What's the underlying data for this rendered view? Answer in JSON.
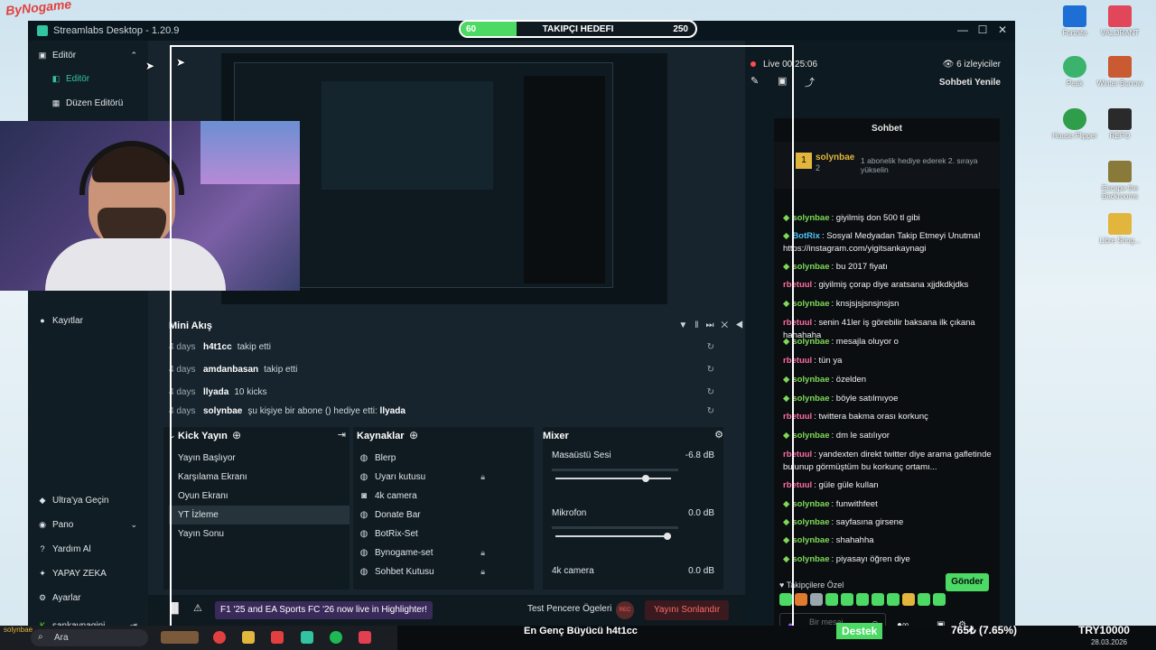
{
  "overlay": {
    "channel_logo": "ByNogame",
    "goal_start": "60",
    "goal_title": "TAKIPÇI HEDEFI",
    "goal_end": "250",
    "goal_progress": 0.24,
    "support_label": "Destek",
    "donation_amount": "765₺ (7.65%)",
    "donation_target": "TRY10000",
    "highlight_label": "En Genç Büyücü h4t1cc",
    "date": "28.03.2026"
  },
  "desktop_icons": [
    "Fortnite",
    "VALORANT",
    "Peak",
    "Winter Burrow",
    "House Flipper",
    "REPO",
    "Escape the Backrooms",
    "Libre Sring..."
  ],
  "window": {
    "title": "Streamlabs Desktop - 1.20.9",
    "minimize_icon": "minimize-icon",
    "maximize_icon": "maximize-icon",
    "close_icon": "close-icon"
  },
  "sidebar": {
    "section": "Editör",
    "items": [
      {
        "label": "Editör",
        "icon": "editor-icon"
      },
      {
        "label": "Düzen Editörü",
        "icon": "layout-icon"
      },
      {
        "label": "Kayıtlar",
        "icon": "record-icon"
      }
    ],
    "bottom": [
      {
        "label": "Ultra'ya Geçin",
        "icon": "ultra-icon"
      },
      {
        "label": "Pano",
        "icon": "dashboard-icon"
      },
      {
        "label": "Yardım Al",
        "icon": "help-icon"
      },
      {
        "label": "YAPAY ZEKA",
        "icon": "ai-icon"
      },
      {
        "label": "Ayarlar",
        "icon": "settings-icon"
      },
      {
        "label": "sankaynagini",
        "icon": "kick-icon"
      }
    ]
  },
  "mini_feed": {
    "title": "Mini Akış",
    "events": [
      {
        "age": "4 days",
        "name": "h4t1cc",
        "text": "takip etti",
        "extra": ""
      },
      {
        "age": "4 days",
        "name": "amdanbasan",
        "text": "takip etti",
        "extra": ""
      },
      {
        "age": "4 days",
        "name": "llyada",
        "text": "10 kicks",
        "extra": ""
      },
      {
        "age": "4 days",
        "name": "solynbae",
        "text": "şu kişiye bir abone () hediye etti:",
        "extra": "llyada"
      }
    ]
  },
  "scenes": {
    "title": "Kick Yayın",
    "items": [
      "Yayın Başlıyor",
      "Karşılama Ekranı",
      "Oyun Ekranı",
      "YT İzleme",
      "Yayın Sonu"
    ],
    "selected": "YT İzleme"
  },
  "sources": {
    "title": "Kaynaklar",
    "items": [
      {
        "label": "Blerp",
        "locked": false
      },
      {
        "label": "Uyarı kutusu",
        "locked": true
      },
      {
        "label": "4k camera",
        "locked": false
      },
      {
        "label": "Donate Bar",
        "locked": false
      },
      {
        "label": "BotRix-Set",
        "locked": false
      },
      {
        "label": "Bynogame-set",
        "locked": true
      },
      {
        "label": "Sohbet Kutusu",
        "locked": true
      }
    ]
  },
  "mixer": {
    "title": "Mixer",
    "channels": [
      {
        "name": "Masaüstü Sesi",
        "db": "-6.8 dB",
        "level": 0.8
      },
      {
        "name": "Mikrofon",
        "db": "0.0 dB",
        "level": 1.0
      },
      {
        "name": "4k camera",
        "db": "0.0 dB",
        "level": 1.0
      }
    ]
  },
  "footer": {
    "highlight": "F1 '25 and EA Sports FC '26 now live in Highlighter!",
    "test_label": "Test Pencere Ögeleri",
    "rec_label": "REC",
    "end_stream": "Yayını Sonlandır"
  },
  "stream": {
    "live_label": "Live 00:25:06",
    "viewers": "6 izleyiciler",
    "refresh_chat": "Sohbeti Yenile",
    "chat_title": "Sohbet",
    "pinned_user": "solynbae",
    "pinned_count": "2",
    "pinned_text": "1 abonelik hediye ederek 2. sıraya yükselin"
  },
  "chat": {
    "messages": [
      {
        "user": "solynbae",
        "color": "#7ed957",
        "text": "giyilmiş don 500 tl gibi"
      },
      {
        "user": "BotRix",
        "color": "#4fc3f7",
        "text": "Sosyal Medyadan Takip Etmeyi Unutma! https://instagram.com/yigitsankaynagi"
      },
      {
        "user": "solynbae",
        "color": "#7ed957",
        "text": "bu 2017 fiyatı"
      },
      {
        "user": "rbetuul",
        "color": "#ff6b9d",
        "text": "giyilmiş çorap diye aratsana xjjdkdkjdks"
      },
      {
        "user": "solynbae",
        "color": "#7ed957",
        "text": "knsjsjsjsnsjnsjsn"
      },
      {
        "user": "rbetuul",
        "color": "#ff6b9d",
        "text": "senin 41ler iş görebilir baksana ilk çıkana hahahaha"
      },
      {
        "user": "solynbae",
        "color": "#7ed957",
        "text": "mesajla oluyor o"
      },
      {
        "user": "rbetuul",
        "color": "#ff6b9d",
        "text": "tün ya"
      },
      {
        "user": "solynbae",
        "color": "#7ed957",
        "text": "özelden"
      },
      {
        "user": "solynbae",
        "color": "#7ed957",
        "text": "böyle satılmıyoe"
      },
      {
        "user": "rbetuul",
        "color": "#ff6b9d",
        "text": "twittera bakma orası korkunç"
      },
      {
        "user": "solynbae",
        "color": "#7ed957",
        "text": "dm le satılıyor"
      },
      {
        "user": "rbetuul",
        "color": "#ff6b9d",
        "text": "yandexten direkt twitter diye arama gafletinde bulunup görmüştüm bu korkunç ortamı..."
      },
      {
        "user": "rbetuul",
        "color": "#ff6b9d",
        "text": "güle güle kullan"
      },
      {
        "user": "solynbae",
        "color": "#7ed957",
        "text": "funwithfeet"
      },
      {
        "user": "solynbae",
        "color": "#7ed957",
        "text": "sayfasına girsene"
      },
      {
        "user": "solynbae",
        "color": "#7ed957",
        "text": "shahahha"
      },
      {
        "user": "solynbae",
        "color": "#7ed957",
        "text": "piyasayı öğren diye"
      }
    ],
    "emote_section": "Takipçilere Özel",
    "input_placeholder": "Bir mesaj gönderin",
    "send_label": "Gönder"
  },
  "taskbar": {
    "search_placeholder": "Ara",
    "user_label": "solynbae"
  }
}
